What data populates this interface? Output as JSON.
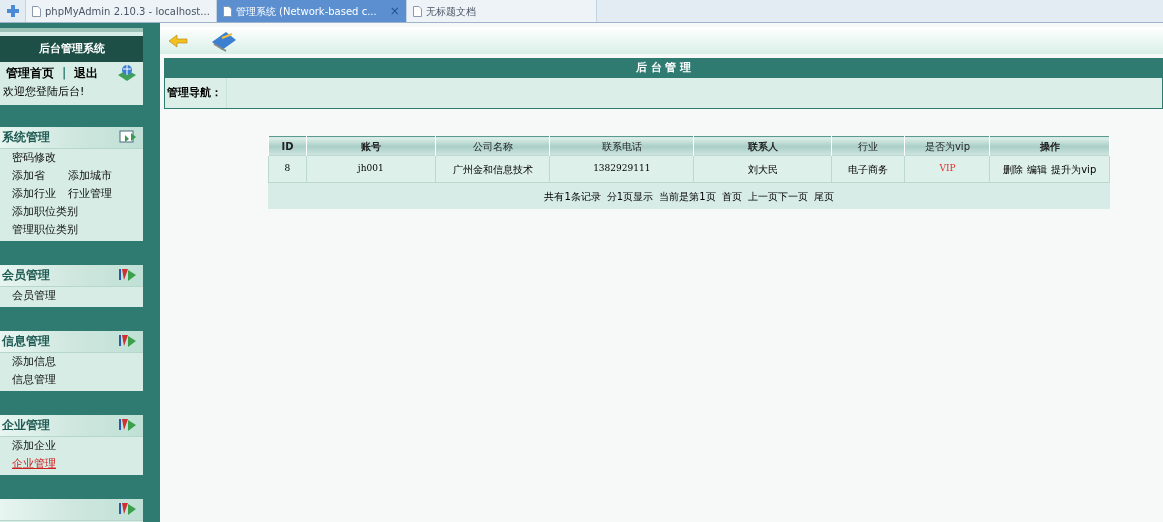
{
  "browser_tabs": [
    {
      "label": "phpMyAdmin 2.10.3 - localhost...",
      "selected": false,
      "closable": false
    },
    {
      "label": "管理系统 (Network-based c...",
      "selected": true,
      "closable": true
    },
    {
      "label": "无标题文档",
      "selected": false,
      "closable": false
    }
  ],
  "browser_tab_close": "×",
  "sidebar": {
    "title": "后台管理系统",
    "home_link": "管理首页",
    "separator": "|",
    "logout_link": "退出",
    "welcome": "欢迎您登陆后台!",
    "groups": [
      {
        "title": "系统管理",
        "rows": [
          [
            {
              "label": "密码修改",
              "selected": false
            }
          ],
          [
            {
              "label": "添加省",
              "selected": false
            },
            {
              "label": "添加城市",
              "selected": false
            }
          ],
          [
            {
              "label": "添加行业",
              "selected": false
            },
            {
              "label": "行业管理",
              "selected": false
            }
          ],
          [
            {
              "label": "添加职位类别",
              "selected": false
            }
          ],
          [
            {
              "label": "管理职位类别",
              "selected": false
            }
          ]
        ]
      },
      {
        "title": "会员管理",
        "rows": [
          [
            {
              "label": "会员管理",
              "selected": false
            }
          ]
        ]
      },
      {
        "title": "信息管理",
        "rows": [
          [
            {
              "label": "添加信息",
              "selected": false
            }
          ],
          [
            {
              "label": "信息管理",
              "selected": false
            }
          ]
        ]
      },
      {
        "title": "企业管理",
        "rows": [
          [
            {
              "label": "添加企业",
              "selected": false
            }
          ],
          [
            {
              "label": "企业管理",
              "selected": true
            }
          ]
        ]
      }
    ]
  },
  "main": {
    "title": "后 台 管 理",
    "nav_label": "管理导航：",
    "table": {
      "columns": [
        {
          "label": "ID",
          "bold": true
        },
        {
          "label": "账号",
          "bold": true
        },
        {
          "label": "公司名称",
          "bold": false
        },
        {
          "label": "联系电话",
          "bold": false
        },
        {
          "label": "联系人",
          "bold": true
        },
        {
          "label": "行业",
          "bold": false
        },
        {
          "label": "是否为vip",
          "bold": false
        },
        {
          "label": "操作",
          "bold": true
        }
      ],
      "rows": [
        {
          "id": "8",
          "account": "jh001",
          "company": "广州金和信息技术",
          "phone": "1382929111",
          "contact": "刘大民",
          "industry": "电子商务",
          "vip": "VIP",
          "actions": [
            "删除",
            "编辑",
            "提升为vip"
          ]
        }
      ]
    },
    "pagination": [
      "共有1条记录",
      "分1页显示",
      "当前是第1页",
      "首页",
      "上一页下一页",
      "尾页"
    ]
  }
}
